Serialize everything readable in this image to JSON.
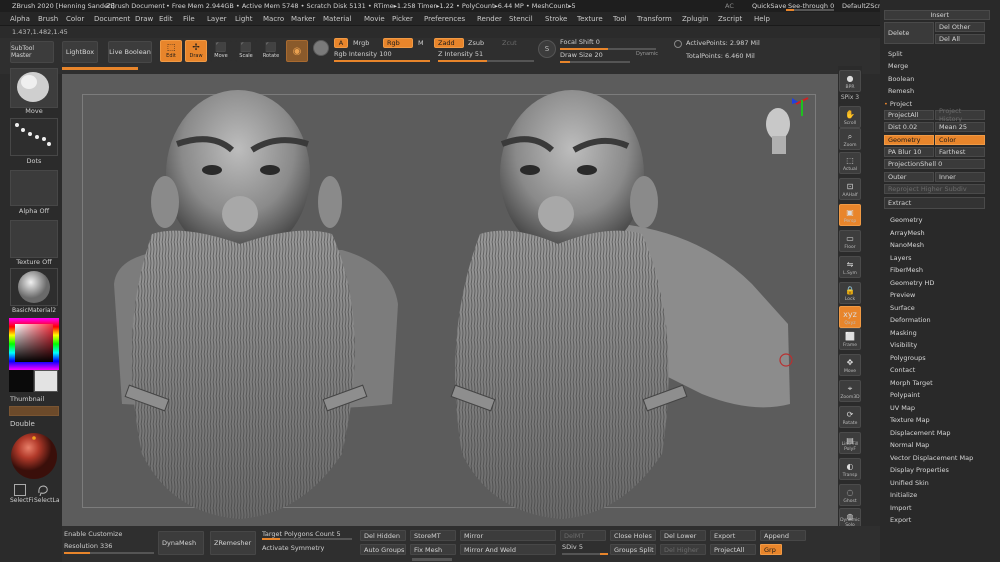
{
  "titlebar": {
    "app": "ZBrush 2020 [Henning Sanden]",
    "document": "ZBrush Document",
    "stats": "• Free Mem 2.944GB • Active Mem 5748 • Scratch Disk 5131 • RTime▸1.258 Timer▸1.22 • PolyCount▸6.44 MP • MeshCount▸5",
    "ac": "AC",
    "quicksave": "QuickSave",
    "seethrough": "See-through  0",
    "zscript": "DefaultZScript"
  },
  "menu": [
    "Alpha",
    "Brush",
    "Color",
    "Document",
    "Draw",
    "Edit",
    "File",
    "Layer",
    "Light",
    "Macro",
    "Marker",
    "Material",
    "Movie",
    "Picker",
    "Preferences",
    "Render",
    "Stencil",
    "Stroke",
    "Texture",
    "Tool",
    "Transform",
    "Zplugin",
    "Zscript",
    "Help"
  ],
  "coords": "1.437,1.482,1.45",
  "toolbar": {
    "subtool_master": "SubTool Master",
    "lightbox": "LightBox",
    "live_boolean": "Live Boolean",
    "edit": "Edit",
    "draw": "Draw",
    "move": "Move",
    "scale": "Scale",
    "rotate": "Rotate",
    "a": "A",
    "mrgb": "Mrgb",
    "rgb": "Rgb",
    "m": "M",
    "zadd": "Zadd",
    "zsub": "Zsub",
    "zcut": "Zcut",
    "rgb_intensity": "Rgb Intensity 100",
    "z_intensity": "Z Intensity 51",
    "focal_shift": "Focal Shift 0",
    "draw_size": "Draw Size 20",
    "dynamic": "Dynamic",
    "active_points": "ActivePoints: 2.987 Mil",
    "total_points": "TotalPoints: 6.460 Mil"
  },
  "leftpanel": {
    "move": "Move",
    "dots": "Dots",
    "alpha_off": "Alpha Off",
    "texture_off": "Texture Off",
    "material": "BasicMaterial2",
    "thumbnail": "Thumbnail",
    "double": "Double",
    "selectfi": "SelectFi",
    "selectla": "SelectLa",
    "colors": {
      "main": "#e3e3e3",
      "secondary": "#0a0a0a",
      "material_red": "#b23a2a"
    }
  },
  "righttools": [
    {
      "icon": "bpr-sphere-icon",
      "label": "BPR"
    },
    {
      "icon": "spix-icon",
      "label": "SPix 3"
    },
    {
      "icon": "scroll-icon",
      "label": "Scroll"
    },
    {
      "icon": "zoom-icon",
      "label": "Zoom"
    },
    {
      "icon": "actual-icon",
      "label": "Actual"
    },
    {
      "icon": "aahalf-icon",
      "label": "AAHalf"
    },
    {
      "icon": "persp-icon",
      "label": "Persp"
    },
    {
      "icon": "floor-icon",
      "label": "Floor"
    },
    {
      "icon": "lsym-icon",
      "label": "L.Sym"
    },
    {
      "icon": "lock-icon",
      "label": "Lock"
    },
    {
      "icon": "xyz-icon",
      "label": "Qxyz"
    },
    {
      "icon": "frame-icon",
      "label": "Frame"
    },
    {
      "icon": "move-icon",
      "label": "Move"
    },
    {
      "icon": "zoom3d-icon",
      "label": "Zoom3D"
    },
    {
      "icon": "rotate-icon",
      "label": "Rotate"
    },
    {
      "icon": "linefill-icon",
      "label": "Line Fill PolyF"
    },
    {
      "icon": "transp-icon",
      "label": "Transp"
    },
    {
      "icon": "ghost-icon",
      "label": "Ghost"
    },
    {
      "icon": "solo-icon",
      "label": "Dynamic Solo"
    },
    {
      "icon": "xpose-icon",
      "label": "Xpose"
    }
  ],
  "rightpanel": {
    "insert": "Insert",
    "delete": "Delete",
    "del_other": "Del Other",
    "del_all": "Del All",
    "split": "Split",
    "merge": "Merge",
    "boolean": "Boolean",
    "remesh": "Remesh",
    "project": "Project",
    "projectall": "ProjectAll",
    "project_history": "Project History",
    "dist": "Dist 0.02",
    "mean": "Mean 25",
    "geometry_btn": "Geometry",
    "color_btn": "Color",
    "pa_blur": "PA Blur 10",
    "farthest": "Farthest",
    "projection_shell": "ProjectionShell 0",
    "outer": "Outer",
    "inner": "Inner",
    "reproject": "Reproject Higher Subdiv",
    "extract": "Extract",
    "subpalettes": [
      "Geometry",
      "ArrayMesh",
      "NanoMesh",
      "Layers",
      "FiberMesh",
      "Geometry HD",
      "Preview",
      "Surface",
      "Deformation",
      "Masking",
      "Visibility",
      "Polygroups",
      "Contact",
      "Morph Target",
      "Polypaint",
      "UV Map",
      "Texture Map",
      "Displacement Map",
      "Normal Map",
      "Vector Displacement Map",
      "Display Properties",
      "Unified Skin",
      "Initialize",
      "Import",
      "Export"
    ]
  },
  "bottombar": {
    "enable_customize": "Enable Customize",
    "resolution": "Resolution 336",
    "dynamesh": "DynaMesh",
    "zremesher": "ZRemesher",
    "target_polygons": "Target Polygons Count 5",
    "activate_symmetry": "Activate Symmetry",
    "del_hidden": "Del Hidden",
    "auto_groups": "Auto Groups",
    "storemt": "StoreMT",
    "fix_mesh": "Fix Mesh",
    "mirror": "Mirror",
    "mirror_and_weld": "Mirror And Weld",
    "delmt": "DelMT",
    "sdiv": "SDiv 5",
    "close_holes": "Close Holes",
    "groups_split": "Groups Split",
    "del_lower": "Del Lower",
    "del_higher": "Del Higher",
    "export": "Export",
    "projectall": "ProjectAll",
    "append": "Append",
    "grp": "Grp"
  },
  "values": {
    "rgb_intensity": 100,
    "z_intensity": 51,
    "focal_shift": 0,
    "draw_size": 20,
    "resolution": 336,
    "sdiv": 5
  }
}
